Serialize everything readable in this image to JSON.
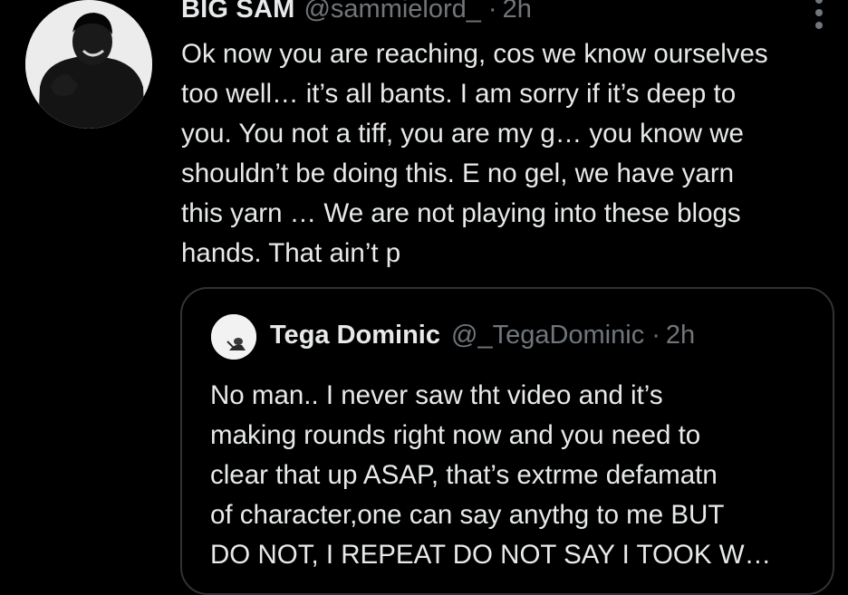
{
  "tweet": {
    "display_name": "BIG SAM",
    "handle": "@sammielord_",
    "separator": "·",
    "time": "2h",
    "body_lines": [
      "Ok now you are reaching, cos we know ourselves",
      "too well… it’s all bants. I am sorry if it’s deep to",
      "you. You not a tiff, you are my g… you know we",
      "shouldn’t be doing this. E no gel, we have yarn",
      "this yarn … We are not playing into these blogs",
      "hands. That ain’t p"
    ],
    "more_icon": "more-vertical-icon"
  },
  "quoted_tweet": {
    "display_name": "Tega Dominic",
    "handle": "@_TegaDominic",
    "separator": "·",
    "time": "2h",
    "body_lines": [
      "No man.. I never saw tht video and it’s",
      "making rounds right now and you need to",
      "clear that up ASAP, that’s extrme defamatn",
      "of character,one can say anythg to me BUT",
      "DO NOT, I REPEAT DO NOT SAY I TOOK W…"
    ]
  },
  "colors": {
    "background": "#000000",
    "primary_text": "#e7e9ea",
    "secondary_text": "#71767b",
    "border": "#2f3336"
  }
}
